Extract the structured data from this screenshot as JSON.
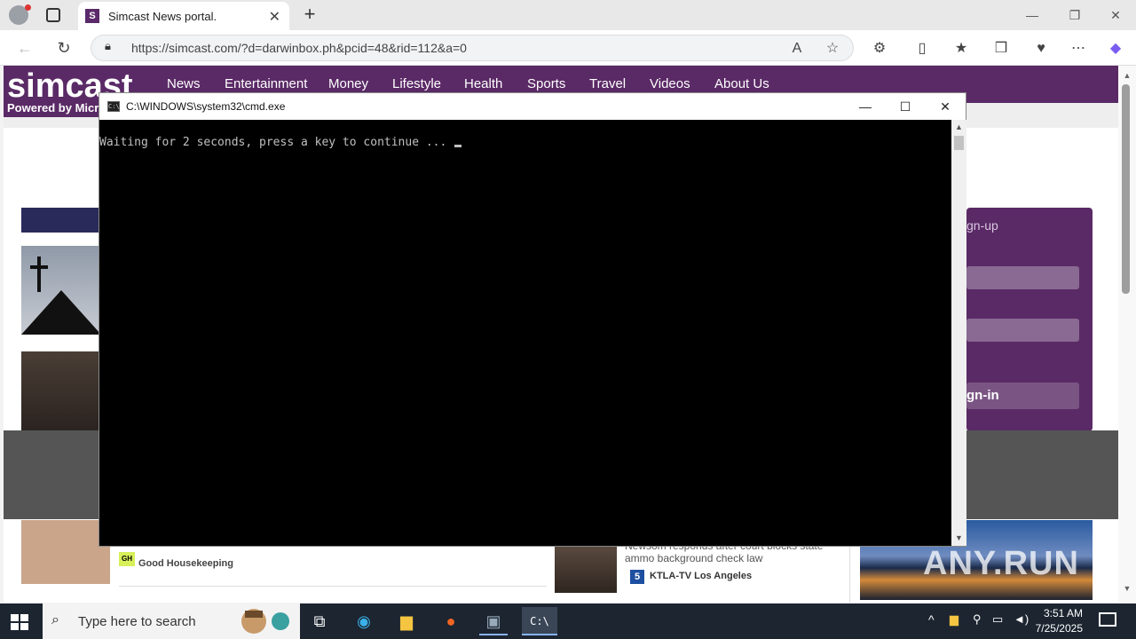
{
  "browser": {
    "tab_title": "Simcast News portal.",
    "url": "https://simcast.com/?d=darwinbox.ph&pcid=48&rid=112&a=0"
  },
  "site": {
    "logo_text": "simcast",
    "logo_sub": "Powered by Micro",
    "nav": [
      "News",
      "Entertainment",
      "Money",
      "Lifestyle",
      "Health",
      "Sports",
      "Travel",
      "Videos",
      "About Us"
    ],
    "side_panel": {
      "signup_text": "gn-up",
      "signin_label": "gn-in"
    },
    "stories": {
      "source_1": "Good Housekeeping",
      "gh_badge": "GH",
      "headline_2": "Newsom responds after court blocks state ammo background check law",
      "source_2": "KTLA-TV Los Angeles",
      "ktla_badge": "5"
    },
    "watermark": "ANY.RUN"
  },
  "cmd": {
    "title": "C:\\WINDOWS\\system32\\cmd.exe",
    "output": "Waiting for 2 seconds, press a key to continue ..."
  },
  "taskbar": {
    "search_placeholder": "Type here to search",
    "time": "3:51 AM",
    "date": "7/25/2025"
  }
}
